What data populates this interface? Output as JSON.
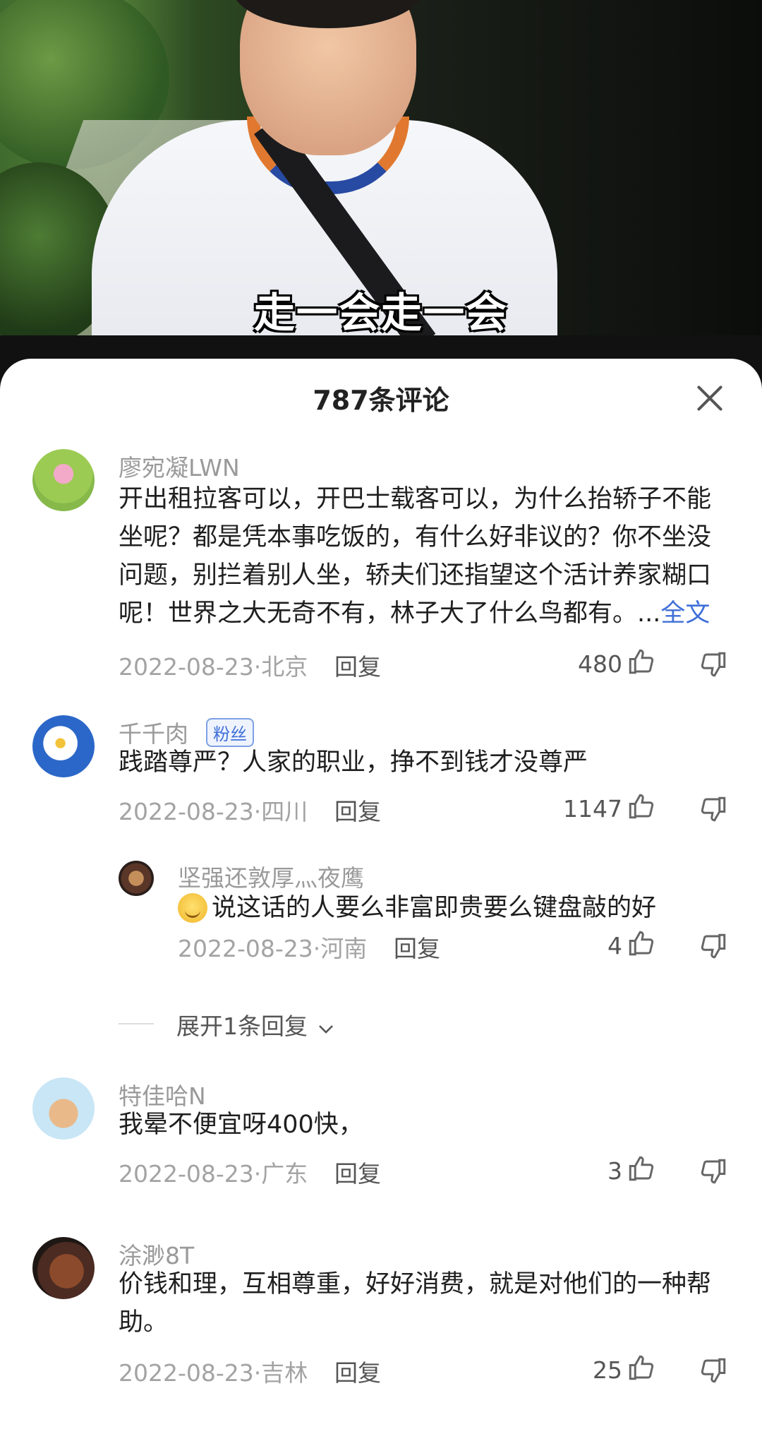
{
  "video": {
    "subtitle": "走一会走一会"
  },
  "panel": {
    "title": "787条评论"
  },
  "comments": [
    {
      "avatar": "lotus-avatar",
      "name": "廖宛凝LWN",
      "text": "开出租拉客可以，开巴士载客可以，为什么抬轿子不能坐呢？都是凭本事吃饭的，有什么好非议的？你不坐没问题，别拦着别人坐，轿夫们还指望这个活计养家糊口呢！世界之大无奇不有，林子大了什么鸟都有。...",
      "more": "全文",
      "meta": "2022-08-23·北京",
      "reply": "回复",
      "likes": "480"
    },
    {
      "avatar": "daisy-avatar",
      "name": "千千肉",
      "badge": "粉丝",
      "text": "践踏尊严？人家的职业，挣不到钱才没尊严",
      "meta": "2022-08-23·四川",
      "reply": "回复",
      "likes": "1147",
      "sub_reply": {
        "name": "坚强还敦厚灬夜鹰",
        "text": "说这话的人要么非富即贵要么键盘敲的好",
        "meta": "2022-08-23·河南",
        "reply": "回复",
        "likes": "4"
      },
      "expand": "展开1条回复"
    },
    {
      "avatar": "bear-avatar",
      "name": "特佳哈N",
      "text": "我晕不便宜呀400快，",
      "meta": "2022-08-23·广东",
      "reply": "回复",
      "likes": "3"
    },
    {
      "avatar": "violin-avatar",
      "name": "涂渺8T",
      "text": "价钱和理，互相尊重，好好消费，就是对他们的一种帮助。",
      "meta": "2022-08-23·吉林",
      "reply": "回复",
      "likes": "25"
    }
  ]
}
